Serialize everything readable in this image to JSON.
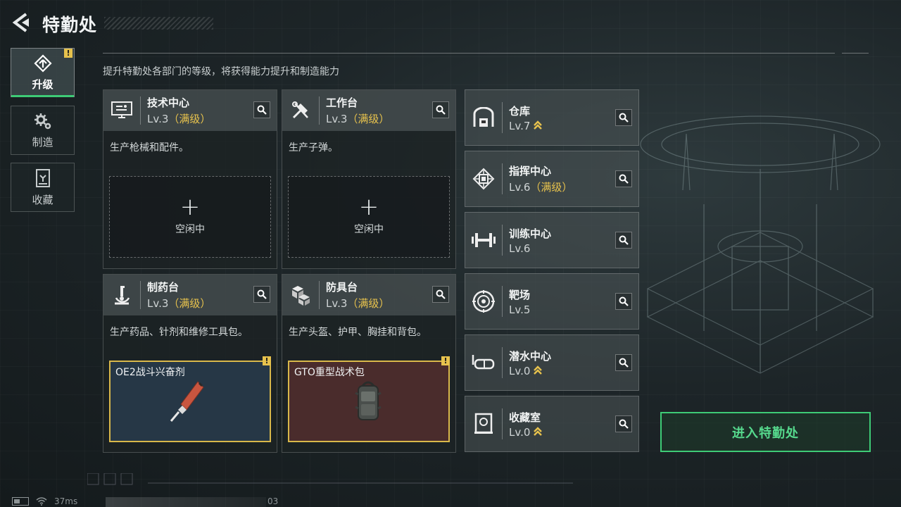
{
  "header": {
    "title": "特勤处"
  },
  "sidebar": {
    "tabs": [
      {
        "label": "升级",
        "icon": "upgrade-icon",
        "active": true,
        "alert": "!"
      },
      {
        "label": "制造",
        "icon": "gears-icon",
        "active": false
      },
      {
        "label": "收藏",
        "icon": "collection-icon",
        "active": false
      }
    ]
  },
  "subtitle": "提升特勤处各部门的等级，将获得能力提升和制造能力",
  "departments": [
    {
      "name": "技术中心",
      "level": "Lv.3",
      "maxed": "（满级）",
      "icon": "tech-center-icon",
      "desc": "生产枪械和配件。",
      "slot": {
        "plus": "+",
        "label": "空闲中"
      }
    },
    {
      "name": "工作台",
      "level": "Lv.3",
      "maxed": "（满级）",
      "icon": "workbench-icon",
      "desc": "生产子弹。",
      "slot": {
        "plus": "+",
        "label": "空闲中"
      }
    },
    {
      "name": "制药台",
      "level": "Lv.3",
      "maxed": "（满级）",
      "icon": "pharmacy-icon",
      "desc": "生产药品、针剂和维修工具包。",
      "slot": {
        "item": "OE2战斗兴奋剂",
        "alert": "!",
        "color": "#263746"
      }
    },
    {
      "name": "防具台",
      "level": "Lv.3",
      "maxed": "（满级）",
      "icon": "armor-bench-icon",
      "desc": "生产头盔、护甲、胸挂和背包。",
      "slot": {
        "item": "GTO重型战术包",
        "alert": "!",
        "color": "#4a2c2c"
      }
    }
  ],
  "facilities": [
    {
      "name": "仓库",
      "level": "Lv.7",
      "maxed": "",
      "upgradable": true,
      "icon": "warehouse-icon"
    },
    {
      "name": "指挥中心",
      "level": "Lv.6",
      "maxed": "（满级）",
      "upgradable": false,
      "icon": "command-center-icon"
    },
    {
      "name": "训练中心",
      "level": "Lv.6",
      "maxed": "",
      "upgradable": false,
      "icon": "training-icon"
    },
    {
      "name": "靶场",
      "level": "Lv.5",
      "maxed": "",
      "upgradable": false,
      "icon": "target-range-icon"
    },
    {
      "name": "潜水中心",
      "level": "Lv.0",
      "maxed": "",
      "upgradable": true,
      "icon": "dive-mask-icon"
    },
    {
      "name": "收藏室",
      "level": "Lv.0",
      "maxed": "",
      "upgradable": true,
      "icon": "collection-room-icon"
    }
  ],
  "enter_button": "进入特勤处",
  "status": {
    "ping": "37ms",
    "uid_suffix": "03"
  },
  "colors": {
    "accent_green": "#3ecb76",
    "gold": "#e7c24d"
  }
}
